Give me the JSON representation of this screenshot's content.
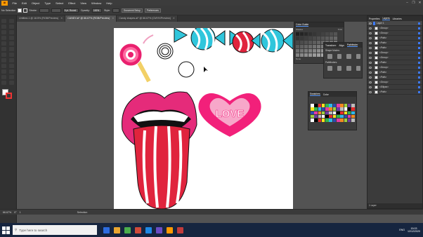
{
  "menubar": {
    "app_logo": "Ai",
    "items": [
      "File",
      "Edit",
      "Object",
      "Type",
      "Select",
      "Effect",
      "View",
      "Window",
      "Help"
    ],
    "window_controls": [
      "–",
      "❐",
      "✕"
    ]
  },
  "controlbar": {
    "selection_label": "No Selection",
    "stroke_label": "Stroke:",
    "stroke_value": "",
    "brush_value": "",
    "profile_value": "5 pt. Round",
    "opacity_label": "Opacity:",
    "opacity_value": "100%",
    "style_label": "Style:",
    "document_setup": "Document Setup",
    "preferences": "Preferences"
  },
  "tabs": [
    {
      "label": "Untitled-1 @ 18.5% (RGB/Preview)",
      "active": false
    },
    {
      "label": "CANDY.ai* @ 66.67% (RGB/Preview)",
      "active": true
    },
    {
      "label": "Candy shapes.ai* @ 66.67% (CMYK/Preview)",
      "active": false
    }
  ],
  "artwork": {
    "love_text": "LOVE"
  },
  "color_guide": {
    "title": "Color Guide",
    "sub_labels": [
      "Shades",
      "Tints",
      "None"
    ]
  },
  "transform_panel": {
    "tabs": [
      "Transform",
      "Align",
      "Pathfinder"
    ],
    "shape_modes": "Shape Modes:",
    "pathfinders": "Pathfinders:"
  },
  "swatches_panel": {
    "tabs": [
      "Swatches",
      "Color"
    ]
  },
  "layers_panel": {
    "tabs": [
      "Properties",
      "Layers",
      "Libraries"
    ],
    "layer_name": "Layer 1",
    "rows": [
      "<Group>",
      "<Group>",
      "<Path>",
      "<Path>",
      "<Path>",
      "<Group>",
      "<Group>",
      "<Path>",
      "<Group>",
      "<Path>",
      "<Path>",
      "<Group>",
      "<Ellipse>",
      "<Path>"
    ],
    "footer": "1 Layer"
  },
  "statusbar": {
    "zoom": "66.67%",
    "rotation": "0°",
    "artboard_num": "1",
    "tool_name": "Selection"
  },
  "taskbar": {
    "search_placeholder": "Type here to search",
    "time": "15:03",
    "date": "12/12/2020",
    "language": "ENG",
    "icon_colors": [
      "#2d6cdf",
      "#e8a530",
      "#4cae4c",
      "#d04a3a",
      "#1e88e5",
      "#6a4cc4",
      "#ff9a00",
      "#c23b3b"
    ]
  }
}
